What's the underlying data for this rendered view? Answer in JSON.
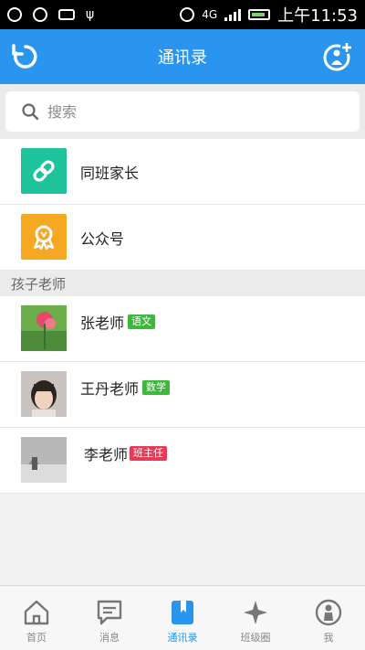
{
  "status_bar": {
    "network_label": "4G",
    "time": "上午11:53"
  },
  "header": {
    "title": "通讯录"
  },
  "search": {
    "placeholder": "搜索"
  },
  "entries": [
    {
      "label": "同班家长",
      "icon": "link-icon",
      "color": "#1ec39c"
    },
    {
      "label": "公众号",
      "icon": "badge-icon",
      "color": "#f6a823"
    }
  ],
  "section": {
    "title": "孩子老师"
  },
  "teachers": [
    {
      "name": "张老师",
      "badge": "语文",
      "badge_color": "#3cb83c"
    },
    {
      "name": "王丹老师",
      "badge": "数学",
      "badge_color": "#3cb83c"
    },
    {
      "name": "李老师",
      "badge": "班主任",
      "badge_color": "#e83a57"
    }
  ],
  "nav": [
    {
      "label": "首页",
      "icon": "home-icon",
      "active": false
    },
    {
      "label": "消息",
      "icon": "message-icon",
      "active": false
    },
    {
      "label": "通讯录",
      "icon": "contacts-icon",
      "active": true
    },
    {
      "label": "班级圈",
      "icon": "class-circle-icon",
      "active": false
    },
    {
      "label": "我",
      "icon": "profile-icon",
      "active": false
    }
  ],
  "colors": {
    "primary": "#2a95ef"
  }
}
